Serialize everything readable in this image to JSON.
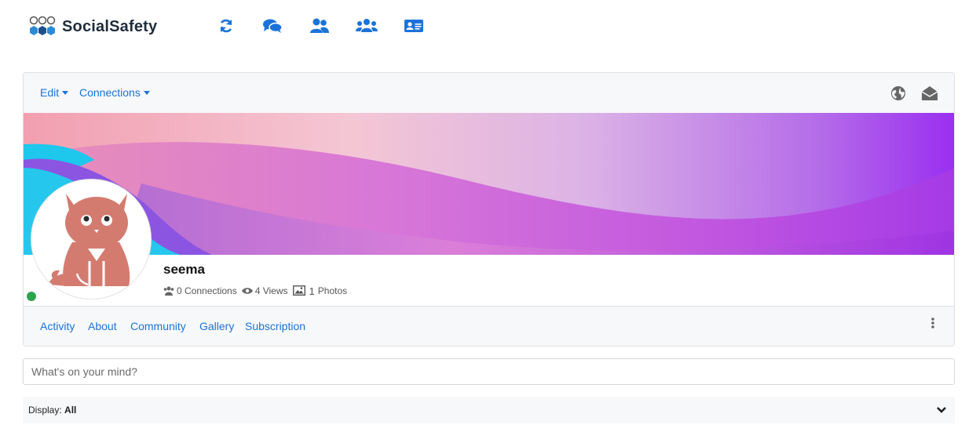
{
  "brand": {
    "name": "SocialSafety"
  },
  "top_nav": [
    {
      "icon": "refresh-icon"
    },
    {
      "icon": "chat-icon"
    },
    {
      "icon": "users-icon"
    },
    {
      "icon": "group-icon"
    },
    {
      "icon": "id-card-icon"
    }
  ],
  "card_header": {
    "edit_label": "Edit",
    "connections_label": "Connections",
    "right_icons": [
      "globe-icon",
      "envelope-open-icon"
    ]
  },
  "profile": {
    "username": "seema",
    "online": true,
    "stats": {
      "connections": "0 Connections",
      "views": "4 Views",
      "photos_count": "1",
      "photos_label": "Photos"
    }
  },
  "tabs": [
    "Activity",
    "About",
    "Community",
    "Gallery",
    "Subscription"
  ],
  "composer": {
    "placeholder": "What's on your mind?"
  },
  "display": {
    "label": "Display:",
    "value": "All"
  },
  "colors": {
    "accent": "#1a73d9",
    "online": "#2da44e",
    "brand_icon": "#2b8bd6",
    "cat": "#d47b70"
  }
}
